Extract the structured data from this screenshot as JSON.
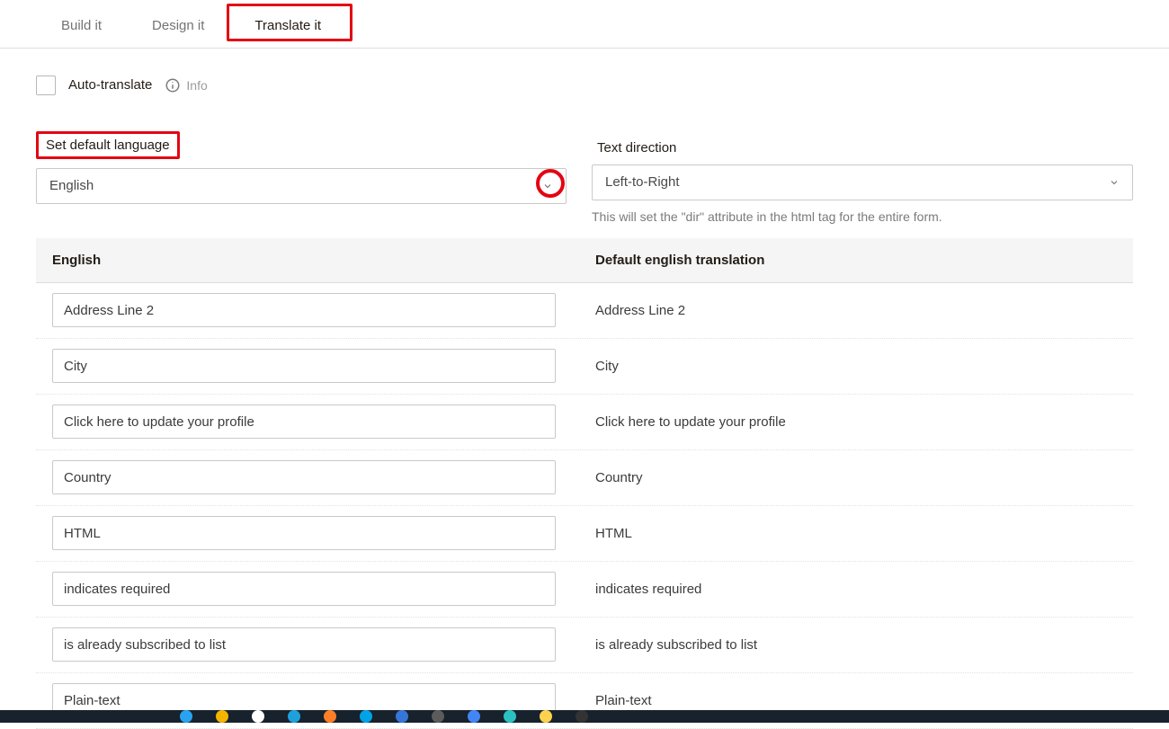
{
  "tabs": {
    "build": "Build it",
    "design": "Design it",
    "translate": "Translate it",
    "active": "translate"
  },
  "auto": {
    "label": "Auto-translate",
    "info_label": "Info"
  },
  "default_language": {
    "label": "Set default language",
    "value": "English"
  },
  "text_direction": {
    "label": "Text direction",
    "value": "Left-to-Right",
    "helper": "This will set the \"dir\" attribute in the html tag for the entire form."
  },
  "table_headers": {
    "left": "English",
    "right": "Default english translation"
  },
  "rows": [
    {
      "input": "Address Line 2",
      "default": "Address Line 2"
    },
    {
      "input": "City",
      "default": "City"
    },
    {
      "input": "Click here to update your profile",
      "default": "Click here to update your profile"
    },
    {
      "input": "Country",
      "default": "Country"
    },
    {
      "input": "HTML",
      "default": "HTML"
    },
    {
      "input": "indicates required",
      "default": "indicates required"
    },
    {
      "input": "is already subscribed to list",
      "default": "is already subscribed to list"
    },
    {
      "input": "Plain-text",
      "default": "Plain-text"
    }
  ],
  "taskbar_colors": [
    "#29a3ef",
    "#f4b400",
    "#ffffff",
    "#1ea0dc",
    "#ff7f27",
    "#00a2e8",
    "#3676d8",
    "#5c5c5c",
    "#4285f4",
    "#2cc1c1",
    "#ffd24d",
    "#333333"
  ]
}
